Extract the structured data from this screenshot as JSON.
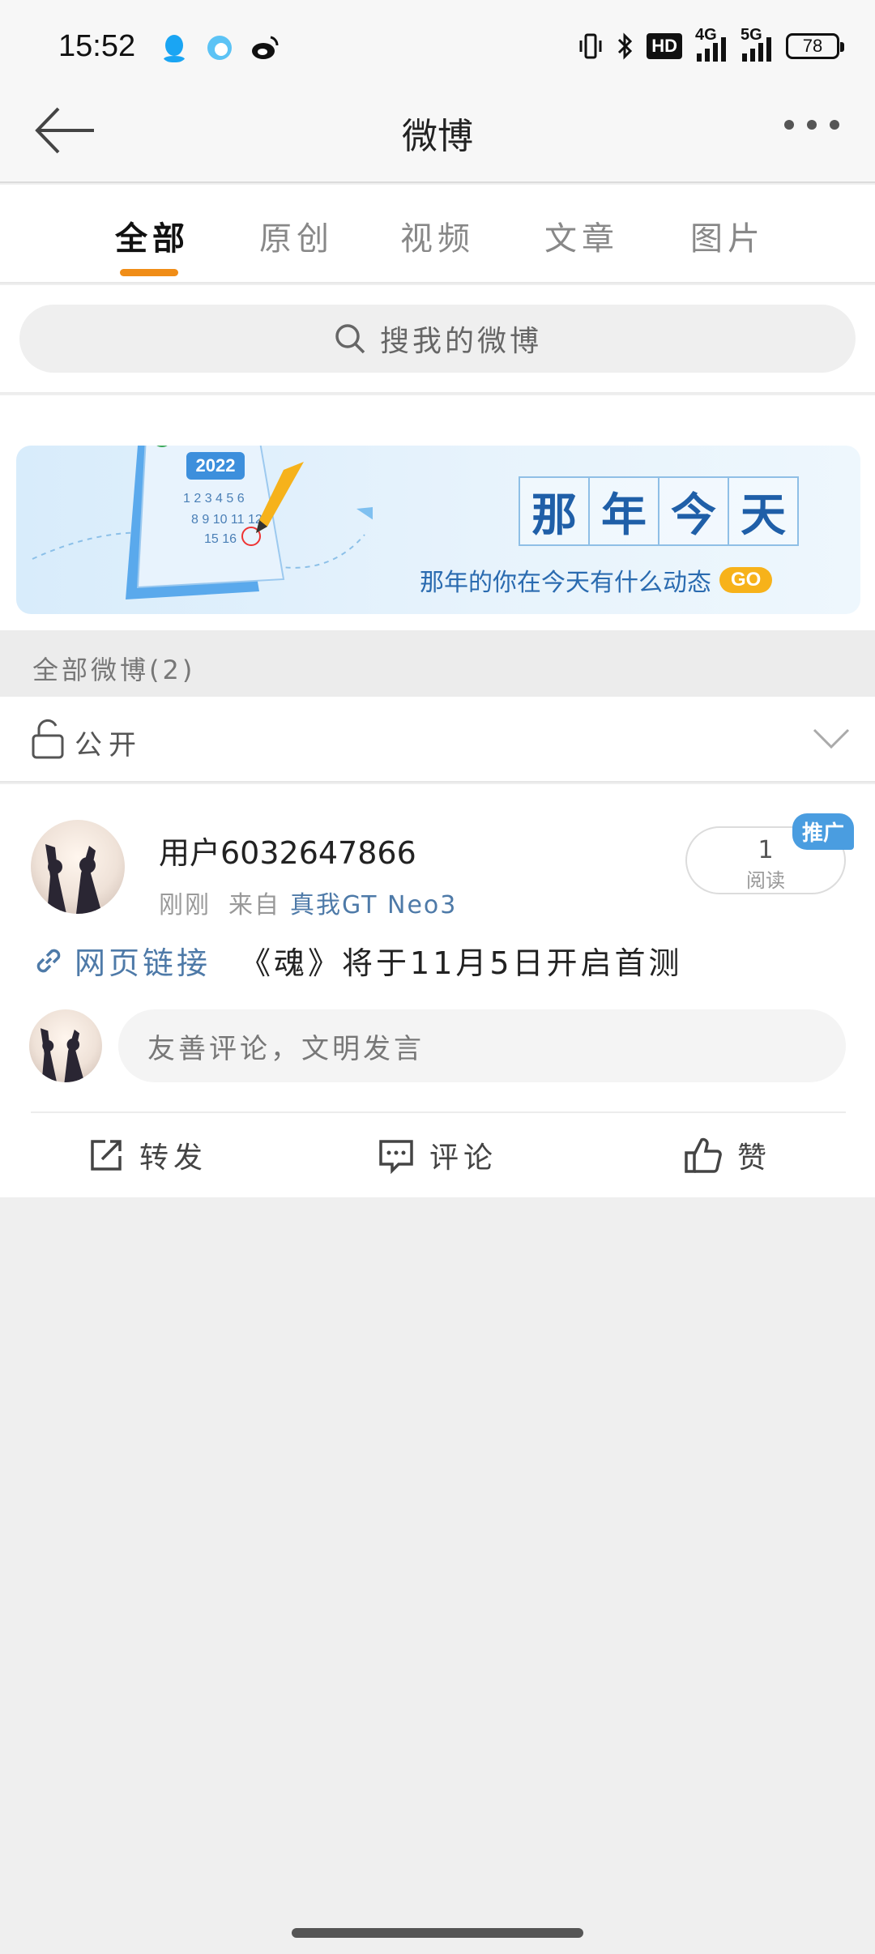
{
  "status_bar": {
    "time": "15:52",
    "app_icons": [
      "qq-icon",
      "browser-icon",
      "weibo-icon"
    ],
    "hd": "HD",
    "net1": "4G",
    "net2": "5G",
    "battery": "78"
  },
  "nav": {
    "title": "微博"
  },
  "tabs": [
    {
      "label": "全部",
      "active": true
    },
    {
      "label": "原创",
      "active": false
    },
    {
      "label": "视频",
      "active": false
    },
    {
      "label": "文章",
      "active": false
    },
    {
      "label": "图片",
      "active": false
    }
  ],
  "search": {
    "placeholder": "搜我的微博"
  },
  "banner": {
    "title_chars": [
      "那",
      "年",
      "今",
      "天"
    ],
    "subtitle": "那年的你在今天有什么动态",
    "go": "GO",
    "calendar_year": "2022"
  },
  "section": {
    "title": "全部微博(2)"
  },
  "visibility": {
    "label": "公开"
  },
  "post": {
    "username": "用户6032647866",
    "time": "刚刚",
    "from_prefix": "来自",
    "source": "真我GT Neo3",
    "read_count": "1",
    "read_label": "阅读",
    "promo_badge": "推广",
    "link_label": "网页链接",
    "content": "《魂》将于11月5日开启首测",
    "comment_placeholder": "友善评论，文明发言"
  },
  "actions": {
    "repost": "转发",
    "comment": "评论",
    "like": "赞"
  },
  "colors": {
    "accent": "#f08d17",
    "link": "#4e7aa8",
    "banner_title": "#1f5fa8",
    "badge": "#4a9de0"
  }
}
